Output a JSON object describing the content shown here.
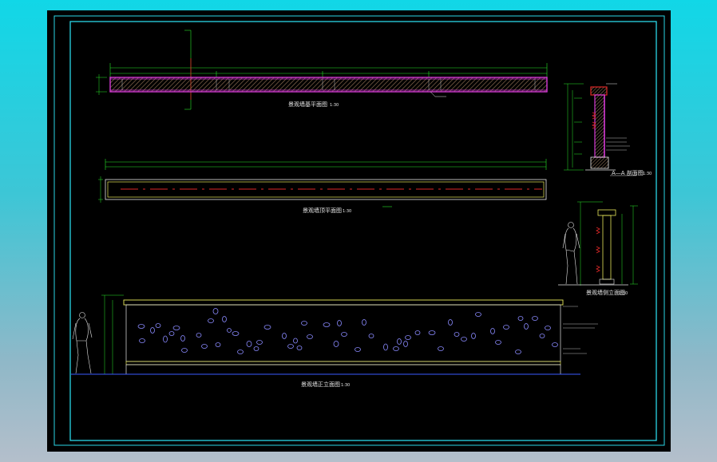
{
  "drawing": {
    "plan_section": {
      "title": "景观墙基平面图",
      "scale": "1:30"
    },
    "top_plan": {
      "title": "景观墙顶平面图",
      "scale": "1:30"
    },
    "section_detail": {
      "title": "A—A 剖面图",
      "scale": "1:30"
    },
    "side_elevation": {
      "title": "景观墙侧立面图",
      "scale": "1:30"
    },
    "front_elevation": {
      "title": "景观墙正立面图",
      "scale": "1:30"
    }
  },
  "colors": {
    "frame": "#2ad6e6",
    "dimension": "#28e628",
    "outline": "#e6e6e6",
    "wall_face": "#e8e85a",
    "section_fill": "#d63ad6",
    "center_line": "#e02828",
    "stones": "#8a8aff",
    "ground": "#3a5aff"
  }
}
